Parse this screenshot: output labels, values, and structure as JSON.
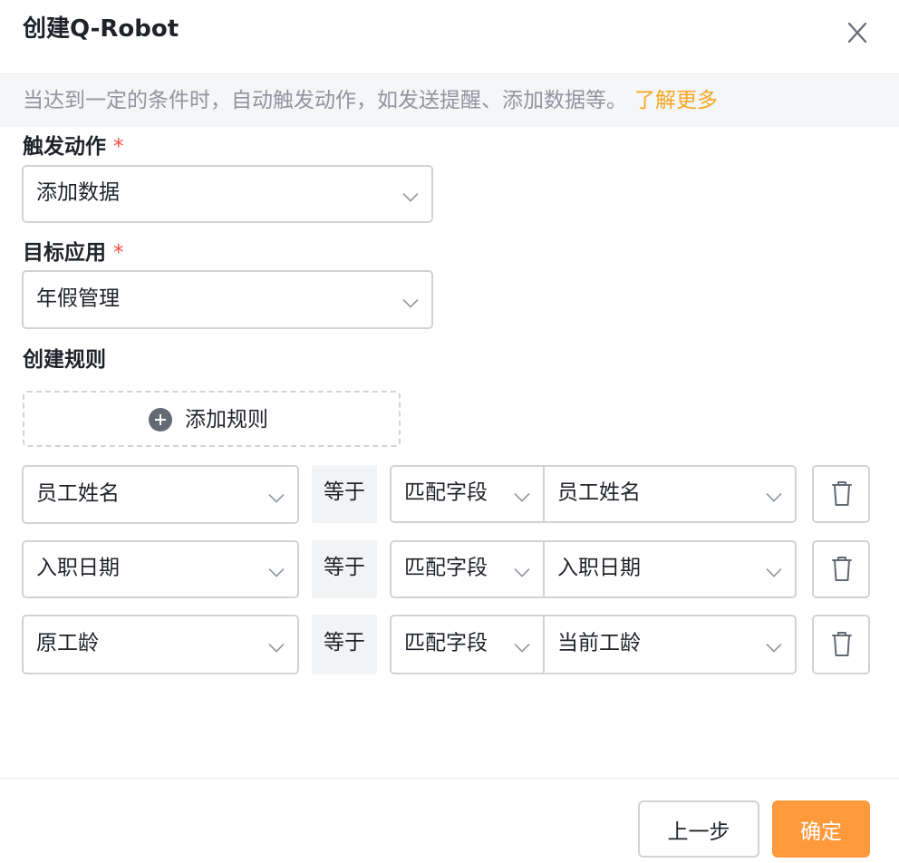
{
  "dialog": {
    "title": "创建Q-Robot"
  },
  "info": {
    "text": "当达到一定的条件时，自动触发动作，如发送提醒、添加数据等。",
    "link": "了解更多"
  },
  "form": {
    "trigger_action": {
      "label": "触发动作",
      "required_mark": "*",
      "value": "添加数据"
    },
    "target_app": {
      "label": "目标应用",
      "required_mark": "*",
      "value": "年假管理"
    },
    "rules_label": "创建规则",
    "add_rule_label": "添加规则"
  },
  "rules": [
    {
      "field": "员工姓名",
      "operator": "等于",
      "match_type": "匹配字段",
      "match_value": "员工姓名"
    },
    {
      "field": "入职日期",
      "operator": "等于",
      "match_type": "匹配字段",
      "match_value": "入职日期"
    },
    {
      "field": "原工龄",
      "operator": "等于",
      "match_type": "匹配字段",
      "match_value": "当前工龄"
    }
  ],
  "footer": {
    "prev_label": "上一步",
    "confirm_label": "确定"
  },
  "colors": {
    "accent": "#ff9a3c",
    "link": "#f5a623",
    "required": "#f54a45"
  }
}
